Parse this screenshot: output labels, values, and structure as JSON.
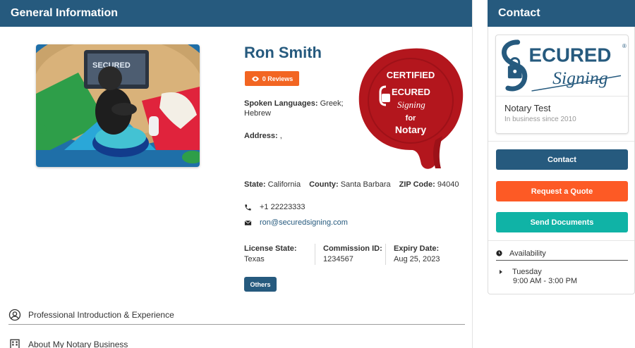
{
  "general": {
    "header": "General Information",
    "name": "Ron Smith",
    "reviews_label": "0 Reviews",
    "languages_label": "Spoken Languages:",
    "languages_value": "Greek; Hebrew",
    "address_label": "Address:",
    "address_value": ",",
    "seal": {
      "line1": "CERTIFIED",
      "brand1": "ECURED",
      "brand2": "Signing",
      "line3": "for",
      "line4": "Notary",
      "color": "#b3161d"
    },
    "state_label": "State:",
    "state_value": "California",
    "county_label": "County:",
    "county_value": "Santa Barbara",
    "zip_label": "ZIP Code:",
    "zip_value": "94040",
    "phone": "+1 22223333",
    "email": "ron@securedsigning.com",
    "license": [
      {
        "label": "License State:",
        "value": "Texas"
      },
      {
        "label": "Commission ID:",
        "value": "1234567"
      },
      {
        "label": "Expiry Date:",
        "value": "Aug 25, 2023"
      }
    ],
    "others_label": "Others",
    "accordion": [
      {
        "label": "Professional Introduction & Experience",
        "icon": "user-circle-icon"
      },
      {
        "label": "About My Notary Business",
        "icon": "building-icon"
      }
    ]
  },
  "contact": {
    "header": "Contact",
    "logo": {
      "brand1": "ECURED",
      "brand2": "Signing",
      "color": "#265a7e"
    },
    "business_name": "Notary Test",
    "since": "In business since 2010",
    "buttons": {
      "contact": "Contact",
      "quote": "Request a Quote",
      "send": "Send Documents"
    },
    "availability_label": "Availability",
    "day": "Tuesday",
    "hours": "9:00 AM - 3:00 PM"
  },
  "colors": {
    "primary": "#265a7e",
    "orange": "#fd5a25",
    "teal": "#10b3a6",
    "review_badge": "#f26522"
  }
}
